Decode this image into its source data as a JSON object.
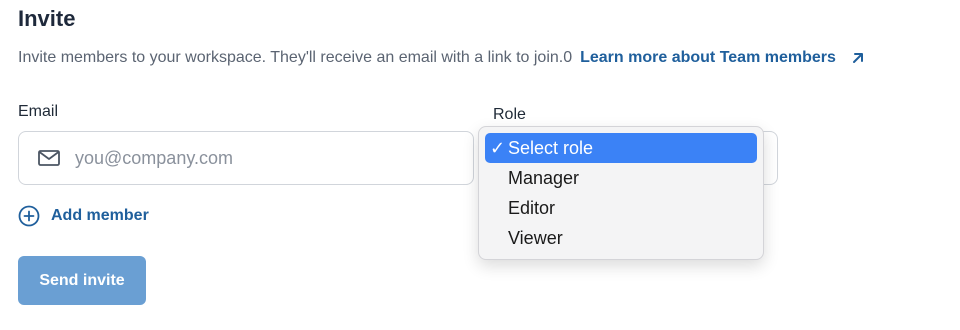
{
  "header": {
    "title": "Invite",
    "subtitle": "Invite members to your workspace. They'll receive an email with a link to join.0",
    "learn_more_link": "Learn more about Team members"
  },
  "form": {
    "email_label": "Email",
    "email_placeholder": "you@company.com",
    "email_value": "",
    "role_label": "Role",
    "role_options": [
      "Select role",
      "Manager",
      "Editor",
      "Viewer"
    ],
    "role_selected": "Select role",
    "check_mark": "✓"
  },
  "actions": {
    "add_member_label": "Add member",
    "send_invite_label": "Send invite"
  },
  "colors": {
    "link": "#1f5f9c",
    "selected_option": "#3b82f6",
    "send_button": "#6a9fd3"
  },
  "icons": {
    "email": "mail-icon",
    "add": "plus-circle-icon",
    "external": "arrow-up-right-icon"
  }
}
